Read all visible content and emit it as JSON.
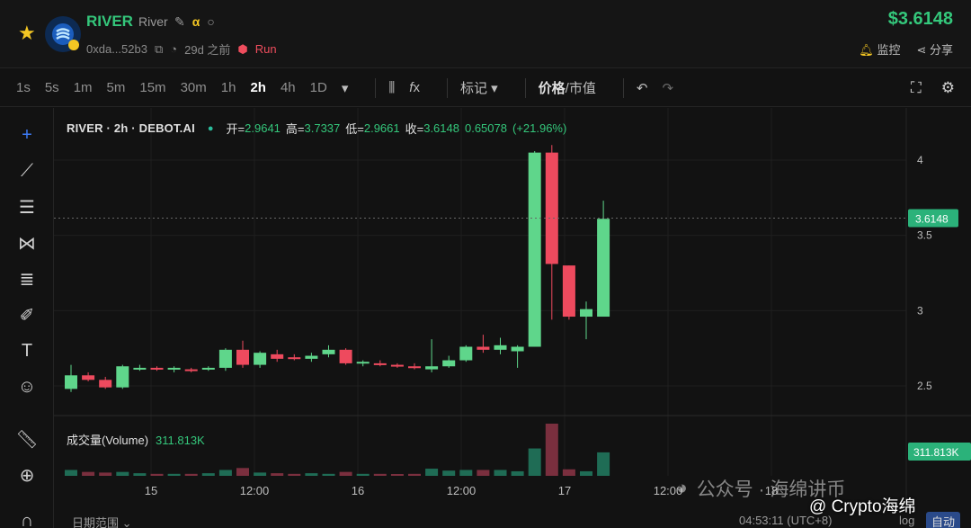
{
  "header": {
    "symbol": "RIVER",
    "name": "River",
    "address": "0xda...52b3",
    "age": "29d 之前",
    "run_label": "Run",
    "price": "$3.6148",
    "monitor_label": "监控",
    "share_label": "分享"
  },
  "toolbar": {
    "timeframes": [
      "1s",
      "5s",
      "1m",
      "5m",
      "15m",
      "30m",
      "1h",
      "2h",
      "4h",
      "1D"
    ],
    "active_timeframe": "2h",
    "marker_label": "标记",
    "price_label": "价格",
    "mcap_label": "市值"
  },
  "legend": {
    "title": "RIVER · 2h · DEBOT.AI",
    "open_label": "开=",
    "open": "2.9641",
    "high_label": "高=",
    "high": "3.7337",
    "low_label": "低=",
    "low": "2.9661",
    "close_label": "收=",
    "close": "3.6148",
    "change": "0.65078",
    "change_pct": "(+21.96%)"
  },
  "volume_legend": {
    "label": "成交量(Volume)",
    "value": "311.813K"
  },
  "chart_data": {
    "type": "candlestick",
    "yaxis_ticks": [
      2.5,
      3,
      3.5,
      4
    ],
    "ylim": [
      2.25,
      4.25
    ],
    "last_price_label": "3.6148",
    "last_price": 3.6148,
    "last_volume_label": "311.813K",
    "xaxis_ticks": [
      "15",
      "12:00",
      "16",
      "12:00",
      "17",
      "12:00",
      "18"
    ],
    "candles": [
      {
        "o": 2.48,
        "h": 2.64,
        "l": 2.46,
        "c": 2.57
      },
      {
        "o": 2.57,
        "h": 2.59,
        "l": 2.53,
        "c": 2.54
      },
      {
        "o": 2.54,
        "h": 2.56,
        "l": 2.48,
        "c": 2.49
      },
      {
        "o": 2.49,
        "h": 2.64,
        "l": 2.48,
        "c": 2.63
      },
      {
        "o": 2.62,
        "h": 2.64,
        "l": 2.6,
        "c": 2.62
      },
      {
        "o": 2.62,
        "h": 2.63,
        "l": 2.6,
        "c": 2.61
      },
      {
        "o": 2.61,
        "h": 2.63,
        "l": 2.59,
        "c": 2.62
      },
      {
        "o": 2.61,
        "h": 2.62,
        "l": 2.59,
        "c": 2.6
      },
      {
        "o": 2.61,
        "h": 2.63,
        "l": 2.6,
        "c": 2.62
      },
      {
        "o": 2.62,
        "h": 2.75,
        "l": 2.6,
        "c": 2.74
      },
      {
        "o": 2.74,
        "h": 2.8,
        "l": 2.62,
        "c": 2.64
      },
      {
        "o": 2.64,
        "h": 2.73,
        "l": 2.62,
        "c": 2.72
      },
      {
        "o": 2.71,
        "h": 2.74,
        "l": 2.66,
        "c": 2.68
      },
      {
        "o": 2.69,
        "h": 2.71,
        "l": 2.67,
        "c": 2.68
      },
      {
        "o": 2.68,
        "h": 2.72,
        "l": 2.66,
        "c": 2.7
      },
      {
        "o": 2.71,
        "h": 2.77,
        "l": 2.69,
        "c": 2.74
      },
      {
        "o": 2.74,
        "h": 2.75,
        "l": 2.64,
        "c": 2.65
      },
      {
        "o": 2.65,
        "h": 2.67,
        "l": 2.63,
        "c": 2.66
      },
      {
        "o": 2.65,
        "h": 2.67,
        "l": 2.63,
        "c": 2.64
      },
      {
        "o": 2.64,
        "h": 2.65,
        "l": 2.62,
        "c": 2.63
      },
      {
        "o": 2.63,
        "h": 2.65,
        "l": 2.61,
        "c": 2.62
      },
      {
        "o": 2.61,
        "h": 2.81,
        "l": 2.59,
        "c": 2.63
      },
      {
        "o": 2.63,
        "h": 2.7,
        "l": 2.62,
        "c": 2.67
      },
      {
        "o": 2.67,
        "h": 2.77,
        "l": 2.66,
        "c": 2.76
      },
      {
        "o": 2.76,
        "h": 2.84,
        "l": 2.72,
        "c": 2.74
      },
      {
        "o": 2.74,
        "h": 2.82,
        "l": 2.71,
        "c": 2.77
      },
      {
        "o": 2.73,
        "h": 2.77,
        "l": 2.62,
        "c": 2.76
      },
      {
        "o": 2.76,
        "h": 4.06,
        "l": 2.76,
        "c": 4.05
      },
      {
        "o": 4.05,
        "h": 4.1,
        "l": 2.94,
        "c": 3.31
      },
      {
        "o": 3.3,
        "h": 3.3,
        "l": 2.94,
        "c": 2.96
      },
      {
        "o": 2.96,
        "h": 3.06,
        "l": 2.81,
        "c": 3.01
      },
      {
        "o": 2.96,
        "h": 3.73,
        "l": 2.96,
        "c": 3.61
      }
    ],
    "volumes": [
      9,
      6,
      5,
      6,
      4,
      3,
      3,
      3,
      4,
      9,
      12,
      5,
      4,
      3,
      4,
      3,
      6,
      3,
      3,
      2,
      3,
      11,
      8,
      9,
      9,
      9,
      7,
      42,
      80,
      10,
      7,
      36
    ]
  },
  "footer": {
    "date_range_label": "日期范围",
    "clock": "04:53:11 (UTC+8)",
    "log_label": "log",
    "auto_label": "自动"
  },
  "watermark": {
    "text": "公众号 · 海绵讲币",
    "credit": "@ Crypto海绵"
  },
  "colors": {
    "up": "#5fd68b",
    "down": "#ee4a5e",
    "up_vol": "#1f6c55",
    "down_vol": "#7a2f3e"
  }
}
